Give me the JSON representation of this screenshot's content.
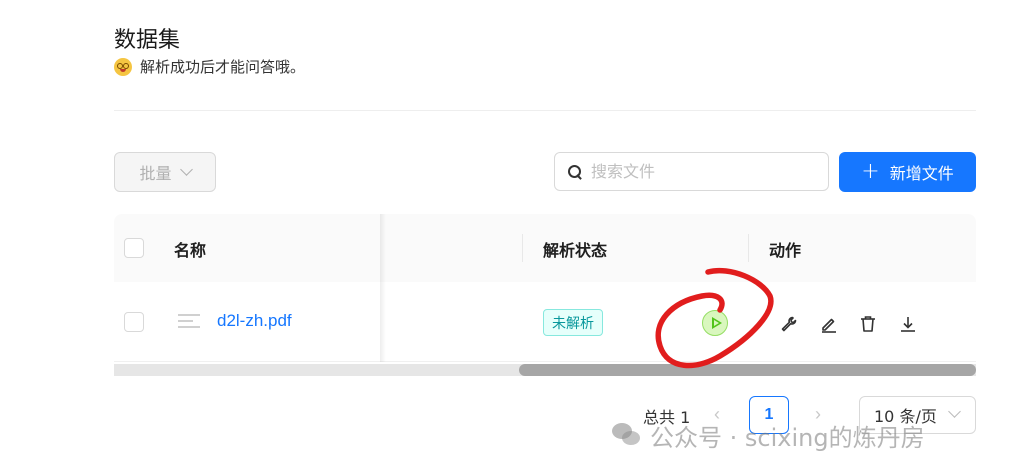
{
  "header": {
    "title": "数据集",
    "subtitle": "解析成功后才能问答哦。",
    "subtitle_icon": "emoji-face-icon"
  },
  "toolbar": {
    "batch_label": "批量",
    "search_placeholder": "搜索文件",
    "add_label": "新增文件"
  },
  "table": {
    "columns": [
      "名称",
      "解析状态",
      "动作"
    ],
    "rows": [
      {
        "name": "d2l-zh.pdf",
        "status": "未解析",
        "actions": [
          "run-icon",
          "wrench-icon",
          "edit-icon",
          "delete-icon",
          "download-icon"
        ]
      }
    ]
  },
  "pagination": {
    "total_label": "总共 1",
    "current_page": "1",
    "page_size": "10 条/页",
    "prev": "‹",
    "next": "›"
  },
  "watermark": {
    "text": "公众号 · scixing的炼丹房"
  },
  "colors": {
    "primary": "#1677ff",
    "status_badge": "#08979c",
    "run_button": "#52c41a",
    "annotation": "#e11d1d"
  }
}
